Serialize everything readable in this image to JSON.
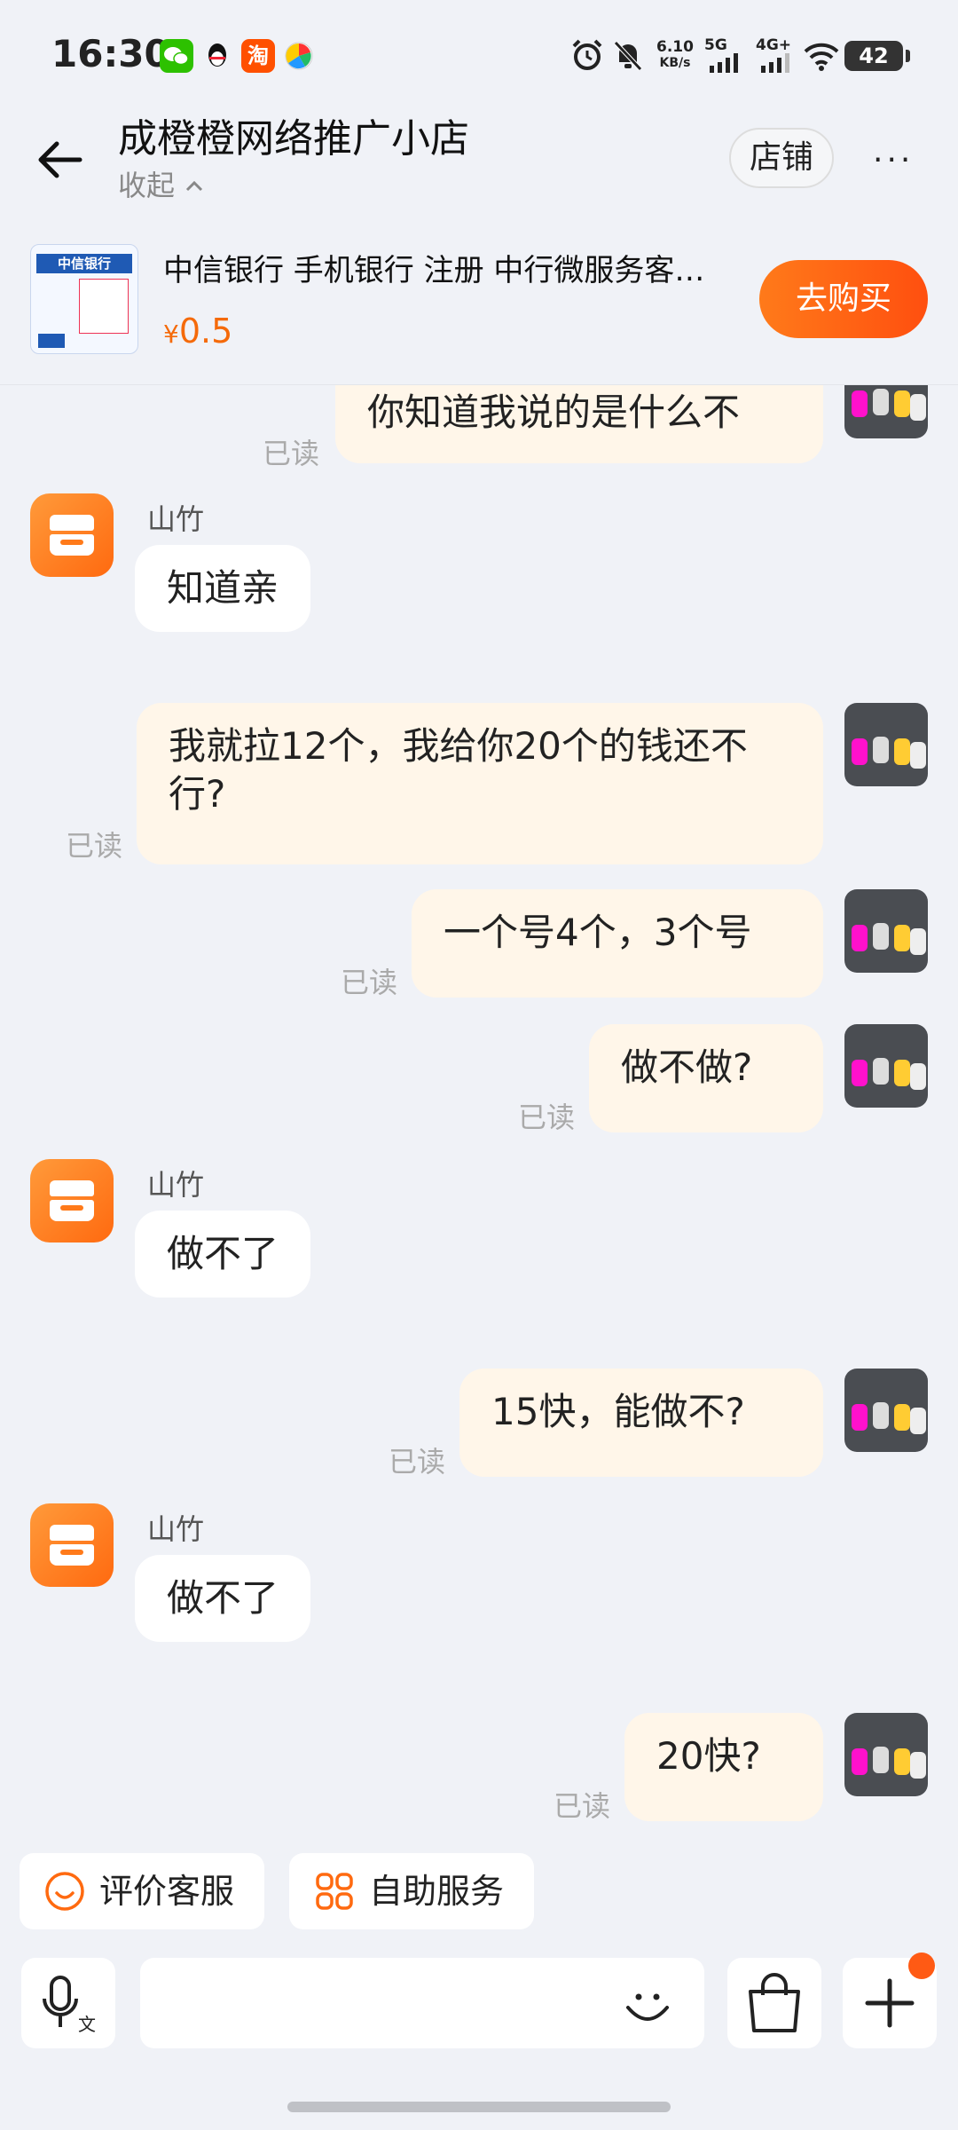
{
  "status_bar": {
    "time": "16:30",
    "speed_value": "6.10",
    "speed_unit": "KB/s",
    "network_1": "5G",
    "network_2": "4G+",
    "battery": "42",
    "app_icons": [
      "wechat-icon",
      "qq-icon",
      "taobao-icon",
      "pinwheel-icon"
    ],
    "system_icons": [
      "alarm-icon",
      "mute-bell-icon",
      "signal-icon",
      "wifi-icon",
      "battery-icon"
    ]
  },
  "header": {
    "title": "成橙橙网络推广小店",
    "collapse_label": "收起",
    "store_button": "店铺",
    "more_label": "···"
  },
  "product": {
    "name": "中信银行 手机银行 注册 中行微服务客…",
    "price_symbol": "¥",
    "price": "0.5",
    "buy_button": "去购买",
    "thumb_label": "中信银行"
  },
  "messages": [
    {
      "side": "me",
      "text": "你知道我说的是什么不",
      "read": "已读"
    },
    {
      "side": "them",
      "sender": "山竹",
      "text": "知道亲"
    },
    {
      "side": "me",
      "text": "我就拉12个，我给你20个的钱还不行?",
      "read": "已读"
    },
    {
      "side": "me",
      "text": "一个号4个，3个号",
      "read": "已读"
    },
    {
      "side": "me",
      "text": "做不做?",
      "read": "已读"
    },
    {
      "side": "them",
      "sender": "山竹",
      "text": "做不了"
    },
    {
      "side": "me",
      "text": "15快，能做不?",
      "read": "已读"
    },
    {
      "side": "them",
      "sender": "山竹",
      "text": "做不了"
    },
    {
      "side": "me",
      "text": "20快?",
      "read": "已读"
    }
  ],
  "quick_actions": {
    "rate_service": "评价客服",
    "self_service": "自助服务"
  },
  "input": {
    "placeholder": "",
    "icons": [
      "voice-to-text-icon",
      "emoji-icon",
      "shopping-bag-icon",
      "plus-icon"
    ]
  },
  "colors": {
    "accent": "#ff6a10",
    "price": "#f56a0a",
    "my_bubble": "#fff6e9",
    "their_bubble": "#ffffff",
    "background": "#f0f2f7"
  }
}
